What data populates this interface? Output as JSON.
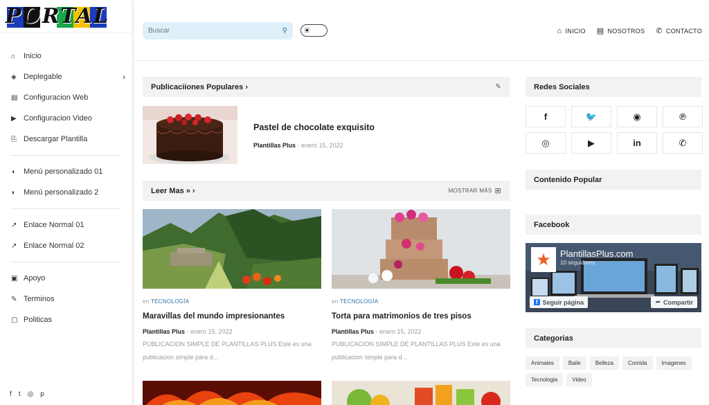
{
  "logo": {
    "text": "PORTAL"
  },
  "sidebar": {
    "groups": [
      [
        {
          "icon": "home-icon",
          "glyph": "⌂",
          "label": "Inicio"
        },
        {
          "icon": "layers-icon",
          "glyph": "◈",
          "label": "Deplegable",
          "chevron": "›"
        },
        {
          "icon": "screen-icon",
          "glyph": "▤",
          "label": "Configuracion Web"
        },
        {
          "icon": "youtube-icon",
          "glyph": "▶",
          "label": "Configuracion Video"
        },
        {
          "icon": "download-file-icon",
          "glyph": "⎘",
          "label": "Descargar Plantilla"
        }
      ],
      [
        {
          "icon": "bell-icon",
          "glyph": "◖",
          "label": "Menú personalizado 01"
        },
        {
          "icon": "bell-ring-icon",
          "glyph": "◗",
          "label": "Menú personalizado 2"
        }
      ],
      [
        {
          "icon": "external-link-icon",
          "glyph": "↗",
          "label": "Enlace Normal 01"
        },
        {
          "icon": "external-link-icon",
          "glyph": "↗",
          "label": "Enlace Normal 02"
        }
      ],
      [
        {
          "icon": "support-icon",
          "glyph": "▣",
          "label": "Apoyo"
        },
        {
          "icon": "edit-icon",
          "glyph": "✎",
          "label": "Terminos"
        },
        {
          "icon": "document-icon",
          "glyph": "▢",
          "label": "Politicas"
        }
      ]
    ],
    "social": [
      "f",
      "t",
      "◎",
      "p"
    ]
  },
  "header": {
    "search_placeholder": "Buscar",
    "search_icon": "⚲",
    "toggle_icon": "☀",
    "nav": [
      {
        "icon": "home-icon",
        "glyph": "⌂",
        "label": "INICIO"
      },
      {
        "icon": "document-icon",
        "glyph": "▤",
        "label": "NOSOTROS"
      },
      {
        "icon": "phone-icon",
        "glyph": "✆",
        "label": "CONTACTO"
      }
    ]
  },
  "popular": {
    "heading": "Publicaciiones Populares ›",
    "pin": "✎",
    "post": {
      "title": "Pastel de chocolate exquisito",
      "author": "Plantillas Plus",
      "date": "enero 15, 2022"
    }
  },
  "leer": {
    "heading": "Leer Mas » ›",
    "more": "MOSTRAR MÁS",
    "more_icon": "⊞",
    "cards": [
      {
        "prefix": "en",
        "category": "TECNOLOGÍA",
        "title": "Maravillas del mundo impresionantes",
        "author": "Plantillas Plus",
        "date": "enero 15, 2022",
        "snippet": "PUBLICACION SIMPLE DE PLANTILLAS PLUS Este es una publicacion simple para d..."
      },
      {
        "prefix": "en",
        "category": "TECNOLOGÍA",
        "title": "Torta para matrimonios de tres pisos",
        "author": "Plantillas Plus",
        "date": "enero 15, 2022",
        "snippet": "PUBLICACION SIMPLE DE PLANTILLAS PLUS Este es una publicacion simple para d..."
      }
    ]
  },
  "right": {
    "social_heading": "Redes Sociales",
    "social_buttons": [
      {
        "icon": "facebook-icon",
        "glyph": "f"
      },
      {
        "icon": "twitter-icon",
        "glyph": "🐦"
      },
      {
        "icon": "reddit-icon",
        "glyph": "◉"
      },
      {
        "icon": "pinterest-icon",
        "glyph": "℗"
      },
      {
        "icon": "instagram-icon",
        "glyph": "◎"
      },
      {
        "icon": "youtube-icon",
        "glyph": "▶"
      },
      {
        "icon": "linkedin-icon",
        "glyph": "in"
      },
      {
        "icon": "whatsapp-icon",
        "glyph": "✆"
      }
    ],
    "popular_heading": "Contenido Popular",
    "facebook_heading": "Facebook",
    "facebook": {
      "page_name": "PlantillasPlus.com",
      "followers": "10 seguidores",
      "follow": "Seguir página",
      "share": "Compartir"
    },
    "categories_heading": "Categorias",
    "categories": [
      "Animales",
      "Baile",
      "Belleza",
      "Comida",
      "Imagenes",
      "Tecnologia",
      "Video"
    ]
  },
  "colors": {
    "accent": "#2b6ea3",
    "search_bg": "#dff0fb",
    "bar_bg": "#f2f2f2"
  }
}
